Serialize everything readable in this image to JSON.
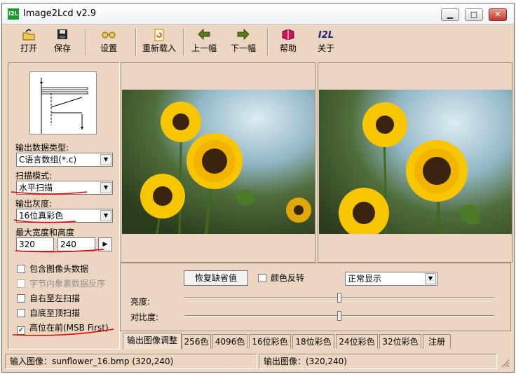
{
  "window": {
    "title": "Image2Lcd v2.9",
    "icon_text": "I2L"
  },
  "toolbar": {
    "open": "打开",
    "save": "保存",
    "settings": "设置",
    "reload": "重新载入",
    "prev": "上一幅",
    "next": "下一幅",
    "help": "帮助",
    "about": "关于",
    "about_icon": "I2L"
  },
  "left": {
    "output_type_label": "输出数据类型:",
    "output_type_value": "C语言数组(*.c)",
    "scan_mode_label": "扫描模式:",
    "scan_mode_value": "水平扫描",
    "gray_label": "输出灰度:",
    "gray_value": "16位真彩色",
    "size_label": "最大宽度和高度",
    "max_width": "320",
    "max_height": "240",
    "options": [
      {
        "label": "包含图像头数据",
        "checked": false,
        "disabled": false
      },
      {
        "label": "字节内象素数据反序",
        "checked": false,
        "disabled": true
      },
      {
        "label": "自右至左扫描",
        "checked": false,
        "disabled": false
      },
      {
        "label": "自底至顶扫描",
        "checked": false,
        "disabled": false
      },
      {
        "label": "高位在前(MSB First)",
        "checked": true,
        "disabled": false
      }
    ]
  },
  "adjust": {
    "restore_default": "恢复缺省值",
    "invert_label": "颜色反转",
    "display_mode": "正常显示",
    "brightness_label": "亮度:",
    "contrast_label": "对比度:",
    "brightness_value": 0.5,
    "contrast_value": 0.5
  },
  "tabs": [
    "输出图像调整",
    "256色",
    "4096色",
    "16位彩色",
    "18位彩色",
    "24位彩色",
    "32位彩色",
    "注册"
  ],
  "status": {
    "input": "输入图像：sunflower_16.bmp (320,240)",
    "output": "输出图像：(320,240)"
  },
  "colors": {
    "panel": "#ecd6c2",
    "annotation_red": "#e00000"
  }
}
